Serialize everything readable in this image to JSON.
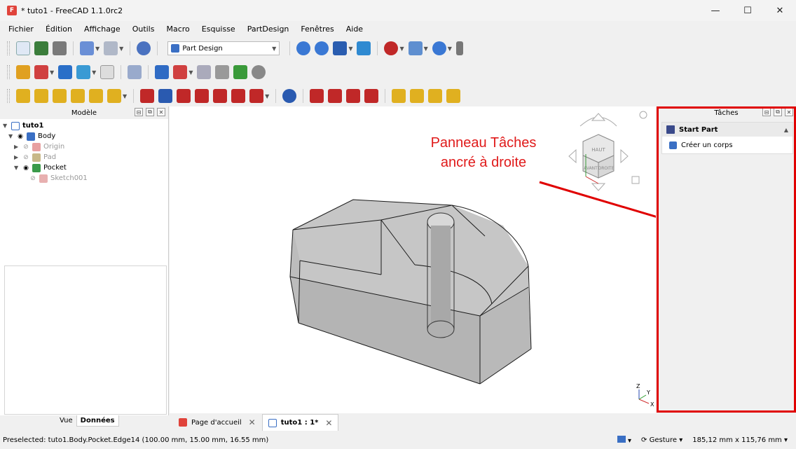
{
  "window": {
    "title": "* tuto1 - FreeCAD 1.1.0rc2",
    "controls": {
      "minimize": "—",
      "maximize": "☐",
      "close": "✕"
    }
  },
  "menu": [
    {
      "label": "Fichier"
    },
    {
      "label": "Édition"
    },
    {
      "label": "Affichage"
    },
    {
      "label": "Outils"
    },
    {
      "label": "Macro"
    },
    {
      "label": "Esquisse"
    },
    {
      "label": "PartDesign"
    },
    {
      "label": "Fenêtres"
    },
    {
      "label": "Aide"
    }
  ],
  "toolbar": {
    "workbench": "Part Design"
  },
  "combo_view": {
    "title": "Modèle",
    "tree": [
      {
        "label": "tuto1",
        "level": 0,
        "expanded": true,
        "state": "normal"
      },
      {
        "label": "Body",
        "level": 1,
        "expanded": true,
        "state": "normal"
      },
      {
        "label": "Origin",
        "level": 2,
        "expanded": false,
        "state": "hidden"
      },
      {
        "label": "Pad",
        "level": 2,
        "expanded": false,
        "state": "hidden"
      },
      {
        "label": "Pocket",
        "level": 2,
        "expanded": true,
        "state": "normal"
      },
      {
        "label": "Sketch001",
        "level": 3,
        "expanded": false,
        "state": "hidden"
      }
    ],
    "tabs": {
      "view": "Vue",
      "data": "Données"
    }
  },
  "document_tabs": [
    {
      "label": "Page d'accueil",
      "active": false
    },
    {
      "label": "tuto1 : 1*",
      "active": true
    }
  ],
  "nav_cube": {
    "top": "HAUT",
    "front": "AVANT",
    "right": "DROITE"
  },
  "axis_labels": {
    "x": "X",
    "y": "Y",
    "z": "Z"
  },
  "task_panel": {
    "title": "Tâches",
    "box_title": "Start Part",
    "items": [
      {
        "label": "Créer un corps"
      }
    ]
  },
  "annotation": {
    "line1": "Panneau Tâches",
    "line2": "ancré à droite",
    "color": "#e01a1a"
  },
  "status_bar": {
    "message": "Preselected: tuto1.Body.Pocket.Edge14 (100.00 mm, 15.00 mm, 16.55 mm)",
    "navigation_style": "Gesture",
    "dimensions": "185,12 mm x 115,76 mm"
  }
}
